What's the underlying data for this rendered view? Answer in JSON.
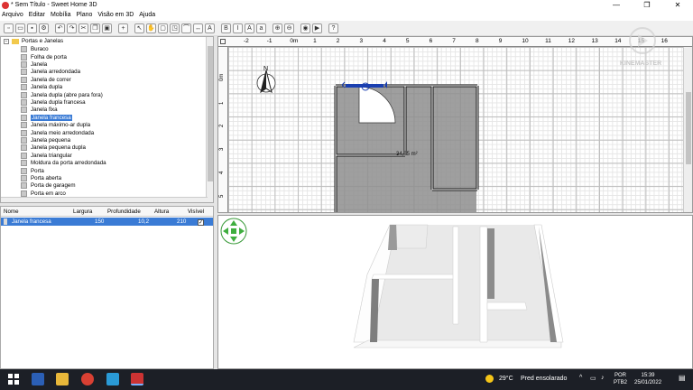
{
  "window": {
    "title": "* Sem Título - Sweet Home 3D",
    "minimize": "—",
    "maximize": "❐",
    "close": "✕"
  },
  "menu": [
    "Arquivo",
    "Editar",
    "Mobília",
    "Plano",
    "Visão em 3D",
    "Ajuda"
  ],
  "catalog": {
    "category": "Portas e Janelas",
    "items": [
      "Buraco",
      "Folha de porta",
      "Janela",
      "Janela arredondada",
      "Janela de correr",
      "Janela dupla",
      "Janela dupla (abre para fora)",
      "Janela dupla francesa",
      "Janela fixa",
      "Janela francesa",
      "Janela máximo-ar dupla",
      "Janela meio arredondada",
      "Janela pequena",
      "Janela pequena dupla",
      "Janela triangular",
      "Moldura da porta arredondada",
      "Porta",
      "Porta aberta",
      "Porta de garagem",
      "Porta em arco",
      "Porta exterior"
    ],
    "selected_index": 9
  },
  "furniture_table": {
    "headers": {
      "name": "Nome",
      "width": "Largura",
      "depth": "Profundidade",
      "height": "Altura",
      "visible": "Visível"
    },
    "rows": [
      {
        "name": "Janela francesa",
        "width": "150",
        "depth": "10,2",
        "height": "210",
        "visible": "✓"
      }
    ]
  },
  "plan": {
    "ruler_top": [
      "-2",
      "-1",
      "0m",
      "1",
      "2",
      "3",
      "4",
      "5",
      "6",
      "7",
      "8",
      "9",
      "10",
      "11",
      "12",
      "13",
      "14",
      "15",
      "16"
    ],
    "ruler_left": [
      "0m",
      "1",
      "2",
      "3",
      "4",
      "5"
    ],
    "room_area": "34,85 m²",
    "compass_label": "N"
  },
  "watermark": "KINEMASTER",
  "taskbar": {
    "weather_temp": "29°C",
    "weather_text": "Pred ensolarado",
    "lang_top": "POR",
    "lang_bottom": "PTB2",
    "time": "15:39",
    "date": "25/01/2022"
  }
}
